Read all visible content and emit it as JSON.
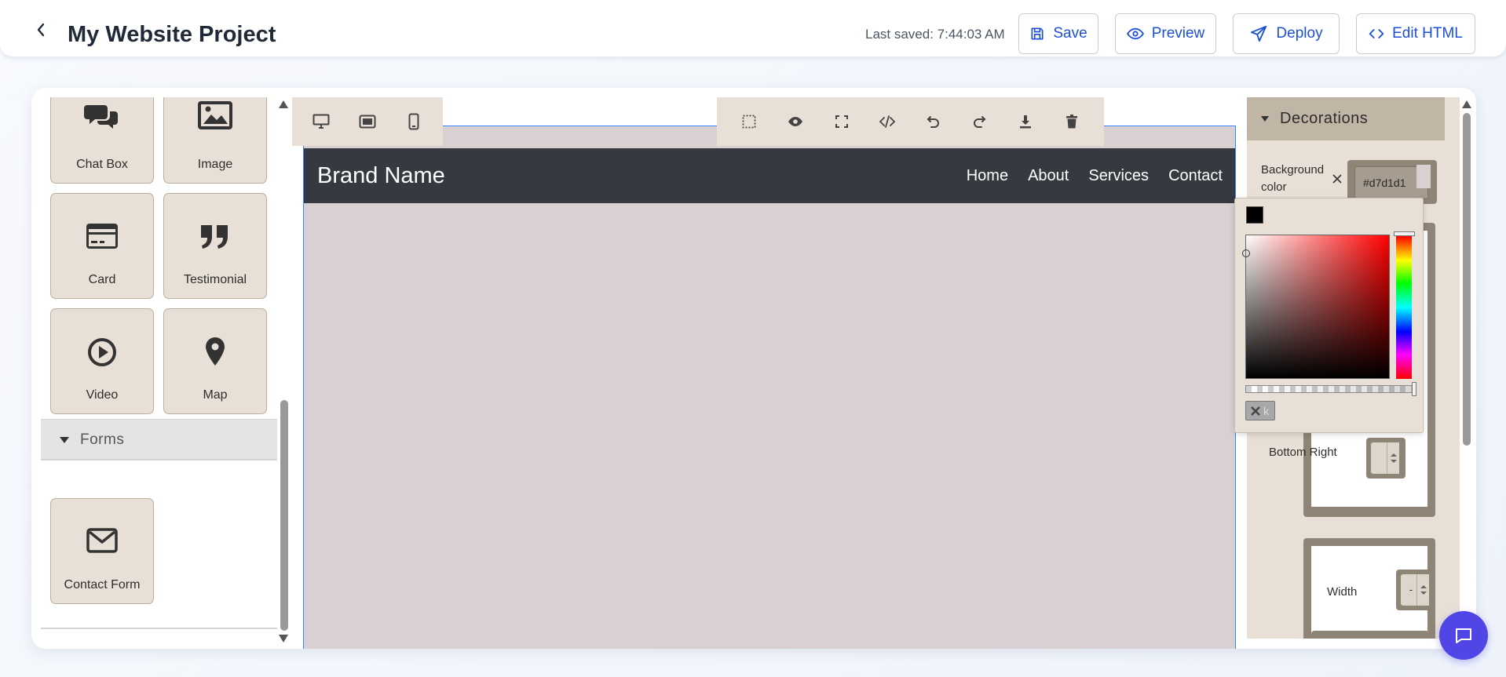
{
  "header": {
    "back_icon": "chevron-left-icon",
    "title": "My Website Project",
    "last_saved": "Last saved: 7:44:03 AM",
    "buttons": [
      {
        "label": "Save",
        "icon": "floppy-disk-icon"
      },
      {
        "label": "Preview",
        "icon": "eye-icon"
      },
      {
        "label": "Deploy",
        "icon": "paper-plane-icon"
      },
      {
        "label": "Edit HTML",
        "icon": "code-icon"
      }
    ],
    "accent_color": "#1d4ed8"
  },
  "blocks_panel": {
    "blocks": [
      {
        "label": "Chat Box",
        "icon": "chat-bubbles-icon"
      },
      {
        "label": "Image",
        "icon": "image-icon"
      },
      {
        "label": "Card",
        "icon": "credit-card-icon"
      },
      {
        "label": "Testimonial",
        "icon": "quote-icon"
      },
      {
        "label": "Video",
        "icon": "play-circle-icon"
      },
      {
        "label": "Map",
        "icon": "map-pin-icon"
      }
    ],
    "forms_section": {
      "title": "Forms",
      "blocks": [
        {
          "label": "Contact Form",
          "icon": "envelope-icon"
        }
      ]
    }
  },
  "canvas": {
    "device_buttons": [
      "desktop-icon",
      "tablet-icon",
      "mobile-icon"
    ],
    "tool_buttons": [
      "select-outline-icon",
      "eye-icon",
      "fullscreen-icon",
      "code-icon",
      "undo-icon",
      "redo-icon",
      "download-icon",
      "trash-icon"
    ],
    "site": {
      "brand": "Brand Name",
      "nav_links": [
        "Home",
        "About",
        "Services",
        "Contact"
      ],
      "nav_bg": "#343a40",
      "page_bg": "#d7d1d1"
    }
  },
  "style_panel": {
    "section_title": "Decorations",
    "background_color_label": "Background color",
    "background_color_value": "#d7d1d1",
    "bottom_right_label": "Bottom Right",
    "width_label": "Width",
    "stepper_value": "-"
  },
  "color_picker": {
    "current_color": "#000000",
    "hue": "#ff0000",
    "clear_label": "k"
  },
  "chat_fab": {
    "icon": "chat-icon",
    "color": "#4f46e5"
  }
}
